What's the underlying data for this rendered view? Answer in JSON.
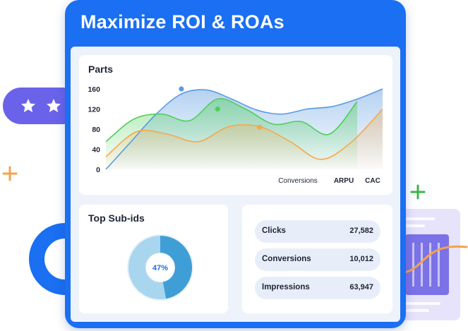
{
  "card": {
    "title": "Maximize ROI & ROAs"
  },
  "colors": {
    "card_blue": "#1a6ff2",
    "series_blue": "#5b9be0",
    "series_green": "#4fcf5a",
    "series_orange": "#f5a84d",
    "deco_purple": "#6a63ea"
  },
  "chart_panel": {
    "title": "Parts",
    "chart_data": {
      "type": "area",
      "yticks": [
        "160",
        "120",
        "80",
        "40",
        "0"
      ],
      "ylim": [
        0,
        160
      ],
      "legend": [
        "Conversions",
        "ARPU",
        "CAC"
      ],
      "legend_position": "bottom-right",
      "grid": false,
      "series": [
        {
          "name": "Conversions",
          "values": [
            0,
            55,
            110,
            150,
            158,
            140,
            118,
            110,
            120,
            125,
            140,
            160
          ]
        },
        {
          "name": "ARPU",
          "values": [
            55,
            100,
            110,
            97,
            140,
            120,
            90,
            95,
            70,
            135
          ]
        },
        {
          "name": "CAC",
          "values": [
            25,
            75,
            70,
            55,
            85,
            85,
            55,
            20,
            55,
            120
          ]
        }
      ],
      "highlighted_points": [
        {
          "series": "Conversions",
          "value": 160
        },
        {
          "series": "ARPU",
          "value": 120
        },
        {
          "series": "CAC",
          "value": 84
        }
      ]
    }
  },
  "subids_panel": {
    "title": "Top Sub-ids",
    "percent": 47,
    "percent_label": "47%"
  },
  "metrics": [
    {
      "label": "Clicks",
      "value": "27,582"
    },
    {
      "label": "Conversions",
      "value": "10,012"
    },
    {
      "label": "Impressions",
      "value": "63,947"
    }
  ],
  "decorations": {
    "rating_stars": 2,
    "icons": [
      "star-icon",
      "plus-icon",
      "ring-icon",
      "wave-icon"
    ]
  }
}
